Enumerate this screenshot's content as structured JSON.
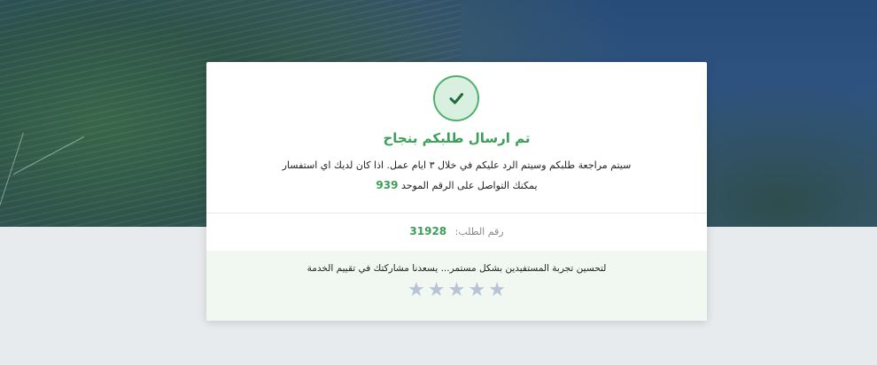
{
  "success": {
    "title": "تم ارسال طلبكم بنجاح",
    "message_line1": "سيتم مراجعة طلبكم وسيتم الرد عليكم في خلال ٣ ايام عمل. اذا كان لديك اي استفسار",
    "message_line2": "يمكنك التواصل على الرقم الموحد",
    "hotline": "939"
  },
  "order": {
    "label": "رقم الطلب:",
    "number": "31928"
  },
  "rating": {
    "prompt": "لتحسين تجربة المستفيدين بشكل مستمر... يسعدنا مشاركتك في تقييم الخدمة",
    "stars": [
      "★",
      "★",
      "★",
      "★",
      "★"
    ],
    "selected": 0,
    "max": 5
  },
  "icons": {
    "success": "check-circle-icon",
    "star": "star-icon"
  },
  "colors": {
    "accent": "#3a9f57",
    "star_empty": "#b8c3d6",
    "rating_bg": "#f1f8f2"
  }
}
